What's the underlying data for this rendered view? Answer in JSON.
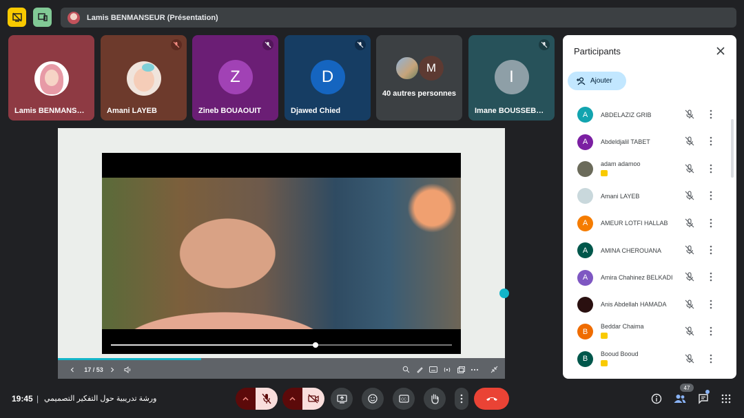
{
  "top_bar": {
    "presenter_label": "Lamis BENMANSEUR (Présentation)",
    "stop_present_icon": "stop-presenting-icon",
    "layout_icon": "devices-icon"
  },
  "tiles": [
    {
      "name": "Lamis BENMANSEUR",
      "display": "Lamis BENMANS…",
      "kind": "photo",
      "bg": "#8e3a43",
      "muted": false
    },
    {
      "name": "Amani LAYEB",
      "display": "Amani LAYEB",
      "kind": "photo",
      "bg": "#6d3a2c",
      "muted": true
    },
    {
      "name": "Zineb BOUAOUIT",
      "display": "Zineb BOUAOUIT",
      "letter": "Z",
      "bg": "#6b1e75",
      "avatar": "#a142b5",
      "muted": true
    },
    {
      "name": "Djawed Chied",
      "display": "Djawed Chied",
      "letter": "D",
      "bg": "#163d63",
      "avatar": "#1565c0",
      "muted": true
    },
    {
      "name": "40 autres personnes",
      "display": "40 autres personnes",
      "kind": "group",
      "bg": "#3c4043",
      "avatar_letter": "M",
      "muted": false
    },
    {
      "name": "Imane BOUSSEBOUA",
      "display": "Imane BOUSSEB…",
      "letter": "I",
      "bg": "#27525a",
      "avatar": "#8e9fa7",
      "muted": true
    }
  ],
  "presentation": {
    "page_indicator": "17 / 53",
    "slide_progress": 0.32,
    "video_progress": 0.6
  },
  "participants_panel": {
    "title": "Participants",
    "add_label": "Ajouter",
    "participants": [
      {
        "name": "ABDELAZIZ GRIB",
        "initial": "A",
        "color": "#12a4af",
        "presenting": false
      },
      {
        "name": "Abdeldjalil TABET",
        "initial": "A",
        "color": "#7b1fa2",
        "presenting": false
      },
      {
        "name": "adam adamoo",
        "initial": "",
        "color": "#6b6b5a",
        "presenting": true
      },
      {
        "name": "Amani LAYEB",
        "initial": "",
        "color": "#c9d8dc",
        "presenting": false
      },
      {
        "name": "AMEUR LOTFI HALLAB",
        "initial": "A",
        "color": "#f57c00",
        "presenting": false
      },
      {
        "name": "AMINA CHEROUANA",
        "initial": "A",
        "color": "#00574b",
        "presenting": false
      },
      {
        "name": "Amira Chahinez BELKADI",
        "initial": "A",
        "color": "#7e57c2",
        "presenting": false
      },
      {
        "name": "Anis Abdellah HAMADA",
        "initial": "",
        "color": "#2a1010",
        "presenting": false
      },
      {
        "name": "Beddar Chaima",
        "initial": "B",
        "color": "#ef6c00",
        "presenting": true
      },
      {
        "name": "Booud Booud",
        "initial": "B",
        "color": "#00574b",
        "presenting": true
      }
    ]
  },
  "bottom_bar": {
    "time": "19:45",
    "separator": "|",
    "meeting_title": "ورشة تدريبية حول التفكير التصميمي",
    "participant_count": "47"
  }
}
